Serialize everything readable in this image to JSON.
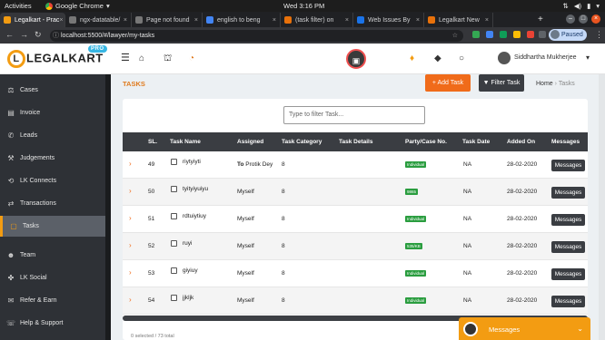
{
  "os": {
    "activities": "Activities",
    "app_name": "Google Chrome",
    "clock": "Wed  3:16 PM"
  },
  "browser": {
    "tabs": [
      {
        "title": "Legalkart - Prac",
        "color": "#f39c12",
        "active": true
      },
      {
        "title": "ngx-datatable/",
        "color": "#777777",
        "active": false
      },
      {
        "title": "Page not found",
        "color": "#777777",
        "active": false
      },
      {
        "title": "english to beng",
        "color": "#4285f4",
        "active": false
      },
      {
        "title": "(task filter) on",
        "color": "#e8710a",
        "active": false
      },
      {
        "title": "Web Issues By",
        "color": "#1a73e8",
        "active": false
      },
      {
        "title": "Legalkart New",
        "color": "#e8710a",
        "active": false
      }
    ],
    "url": "localhost:5500/#/lawyer/my-tasks",
    "profile_status": "Paused"
  },
  "header": {
    "logo_text": "LEGALKART",
    "logo_badge": "PRO",
    "user_name": "Siddhartha Mukherjee"
  },
  "sidebar": {
    "items": [
      {
        "label": "Cases",
        "icon": "gavel-icon",
        "glyph": "⚖"
      },
      {
        "label": "Invoice",
        "icon": "invoice-icon",
        "glyph": "▤"
      },
      {
        "label": "Leads",
        "icon": "leads-icon",
        "glyph": "✆"
      },
      {
        "label": "Judgements",
        "icon": "judgement-icon",
        "glyph": "⚒"
      },
      {
        "label": "LK Connects",
        "icon": "connect-icon",
        "glyph": "⟲"
      },
      {
        "label": "Transactions",
        "icon": "transactions-icon",
        "glyph": "⇄"
      },
      {
        "label": "Tasks",
        "icon": "tasks-icon",
        "glyph": "▢",
        "active": true
      },
      {
        "label": "Team",
        "icon": "team-icon",
        "glyph": "☻"
      },
      {
        "label": "LK Social",
        "icon": "social-icon",
        "glyph": "✤"
      },
      {
        "label": "Refer & Earn",
        "icon": "refer-icon",
        "glyph": "✉"
      },
      {
        "label": "Help & Support",
        "icon": "help-icon",
        "glyph": "☏"
      }
    ]
  },
  "page": {
    "title": "TASKS",
    "add_task_label": "+ Add Task",
    "filter_task_label": "Filter Task",
    "breadcrumb_home": "Home",
    "breadcrumb_sep": "›",
    "breadcrumb_current": "Tasks",
    "filter_placeholder": "Type to filter Task..."
  },
  "table": {
    "columns": [
      "SL.",
      "Task Name",
      "Assigned",
      "Task Category",
      "Task Details",
      "Party/Case No.",
      "Task Date",
      "Added On",
      "Messages"
    ],
    "rows": [
      {
        "sl": "49",
        "name": "riytyiyti",
        "assigned_prefix": "To",
        "assigned": "Protik Dey",
        "category": "8",
        "badge": "Individual",
        "date": "NA",
        "added": "28-02-2020",
        "msg": "Messages"
      },
      {
        "sl": "50",
        "name": "tyityiyuiyu",
        "assigned_prefix": "",
        "assigned": "Myself",
        "category": "8",
        "badge": "9865",
        "date": "NA",
        "added": "28-02-2020",
        "msg": "Messages"
      },
      {
        "sl": "51",
        "name": "rdtuiytiuy",
        "assigned_prefix": "",
        "assigned": "Myself",
        "category": "8",
        "badge": "Individual",
        "date": "NA",
        "added": "28-02-2020",
        "msg": "Messages"
      },
      {
        "sl": "52",
        "name": "ruyi",
        "assigned_prefix": "",
        "assigned": "Myself",
        "category": "8",
        "badge": "535/KB",
        "date": "NA",
        "added": "28-02-2020",
        "msg": "Messages"
      },
      {
        "sl": "53",
        "name": "giyiuy",
        "assigned_prefix": "",
        "assigned": "Myself",
        "category": "8",
        "badge": "Individual",
        "date": "NA",
        "added": "28-02-2020",
        "msg": "Messages"
      },
      {
        "sl": "54",
        "name": "jjkljk",
        "assigned_prefix": "",
        "assigned": "Myself",
        "category": "8",
        "badge": "Individual",
        "date": "NA",
        "added": "28-02-2020",
        "msg": "Messages"
      }
    ],
    "footer": "0 selected / 73 total"
  },
  "messages_widget": {
    "label": "Messages"
  }
}
